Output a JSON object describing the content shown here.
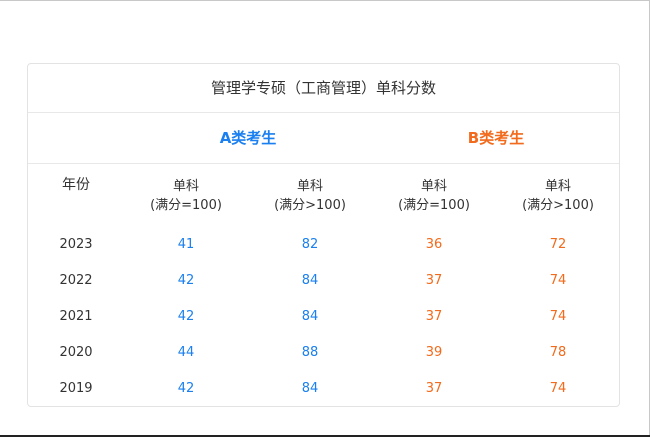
{
  "table": {
    "title": "管理学专硕（工商管理）单科分数",
    "group_a": "A类考生",
    "group_b": "B类考生",
    "headers": {
      "year": "年份",
      "a_single_100": [
        "单科",
        "(满分=100)"
      ],
      "a_single_gt100": [
        "单科",
        "(满分>100)"
      ],
      "b_single_100": [
        "单科",
        "(满分=100)"
      ],
      "b_single_gt100": [
        "单科",
        "(满分>100)"
      ]
    },
    "rows": [
      {
        "year": "2023",
        "a1": "41",
        "a2": "82",
        "b1": "36",
        "b2": "72"
      },
      {
        "year": "2022",
        "a1": "42",
        "a2": "84",
        "b1": "37",
        "b2": "74"
      },
      {
        "year": "2021",
        "a1": "42",
        "a2": "84",
        "b1": "37",
        "b2": "74"
      },
      {
        "year": "2020",
        "a1": "44",
        "a2": "88",
        "b1": "39",
        "b2": "78"
      },
      {
        "year": "2019",
        "a1": "42",
        "a2": "84",
        "b1": "37",
        "b2": "74"
      }
    ]
  },
  "colors": {
    "group_a": "#1a7ff0",
    "group_b": "#f26a1b"
  }
}
